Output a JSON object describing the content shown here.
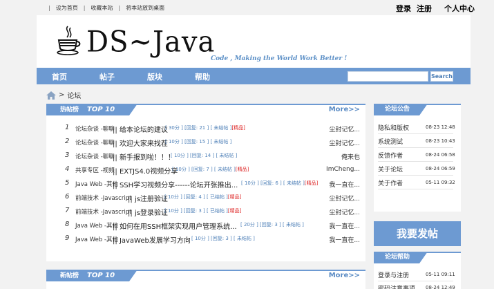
{
  "topbar": {
    "links": [
      "设为首页",
      "收藏本站",
      "将本站放到桌面"
    ],
    "login": "登录",
    "register": "注册",
    "profile": "个人中心"
  },
  "header": {
    "logo_text": "DS~Java",
    "slogan": "Code , Making the World Work Better !"
  },
  "nav": {
    "items": [
      "首页",
      "帖子",
      "版块",
      "帮助"
    ],
    "search_placeholder": "",
    "search_label": "Search"
  },
  "breadcrumb": {
    "gt": ">",
    "label": "论坛"
  },
  "hot": {
    "title": "热帖榜",
    "title_en": "TOP 10",
    "more": "More>>",
    "rows": [
      {
        "num": "1",
        "cat": "论坛杂谈 -聊聊",
        "sep": "||",
        "title": "给本论坛的建议",
        "meta": "[ 30分 ] [回复: 21 ] [ 未结帖 ]",
        "hot": "[精品]",
        "author": "尘封记忆..."
      },
      {
        "num": "2",
        "cat": "论坛杂谈 -聊聊",
        "sep": "||",
        "title": "欢迎大家来找茬",
        "meta": "[ 10分 ] [回复: 15 ] [ 未结帖 ]",
        "hot": "",
        "author": "尘封记忆..."
      },
      {
        "num": "3",
        "cat": "论坛杂谈 -聊聊",
        "sep": "||",
        "title": "新手报到啦！！！",
        "meta": "[ 10分 ] [回复: 14 ] [ 未结帖 ]",
        "hot": "",
        "author": "俺来也"
      },
      {
        "num": "4",
        "cat": "共享专区 -视频",
        "sep": "||",
        "title": "EXTJS4.0视频分享",
        "meta": "[ 10分 ] [回复: 7 ] [ 未结帖 ]",
        "hot": "[精品]",
        "author": "ImCheng..."
      },
      {
        "num": "5",
        "cat": "Java Web -其他",
        "sep": "||",
        "title": "SSH学习视频分享------论坛开张推出...",
        "meta": "[ 10分 ] [回复: 6 ] [ 未结帖 ]",
        "hot": "[精品]",
        "author": "我一直在..."
      },
      {
        "num": "6",
        "cat": "前端技术 -Javascript",
        "sep": "||",
        "title": "js注册验证",
        "meta": "[ 10分 ] [回复: 4 ] [ 已结帖 ]",
        "hot": "[精品]",
        "author": "尘封记忆..."
      },
      {
        "num": "7",
        "cat": "前端技术 -Javascript",
        "sep": "||",
        "title": "js登录验证",
        "meta": "[ 10分 ] [回复: 3 ] [ 已结帖 ]",
        "hot": "[精品]",
        "author": "尘封记忆..."
      },
      {
        "num": "8",
        "cat": "Java Web -其他",
        "sep": "||",
        "title": "如何在用SSH框架实现用户管理系统...",
        "meta": "[ 20分 ] [回复: 3 ] [ 未结帖 ]",
        "hot": "",
        "author": "我一直在..."
      },
      {
        "num": "9",
        "cat": "Java Web -其他",
        "sep": "||",
        "title": "JavaWeb发展学习方向",
        "meta": "[ 10分 ] [回复: 3 ] [ 未结帖 ]",
        "hot": "",
        "author": "我一直在..."
      }
    ]
  },
  "newposts": {
    "title": "新帖榜",
    "title_en": "TOP 10",
    "more": "More>>"
  },
  "notice": {
    "title": "论坛公告",
    "items": [
      {
        "label": "隐私和版权",
        "date": "08-23 12:48"
      },
      {
        "label": "系统测试",
        "date": "08-23 10:43"
      },
      {
        "label": "反馈作者",
        "date": "08-24 06:58"
      },
      {
        "label": "关于论坛",
        "date": "08-24 06:59"
      },
      {
        "label": "关于作者",
        "date": "05-11 09:32"
      }
    ]
  },
  "post_button": "我要发帖",
  "help": {
    "title": "论坛帮助",
    "items": [
      {
        "label": "登录与注册",
        "date": "05-11 09:11"
      },
      {
        "label": "密码注意事项",
        "date": "08-24 12:49"
      }
    ]
  },
  "colors": {
    "accent": "#6d9ad2",
    "link": "#4d7fb7",
    "hot": "#dd2222"
  }
}
